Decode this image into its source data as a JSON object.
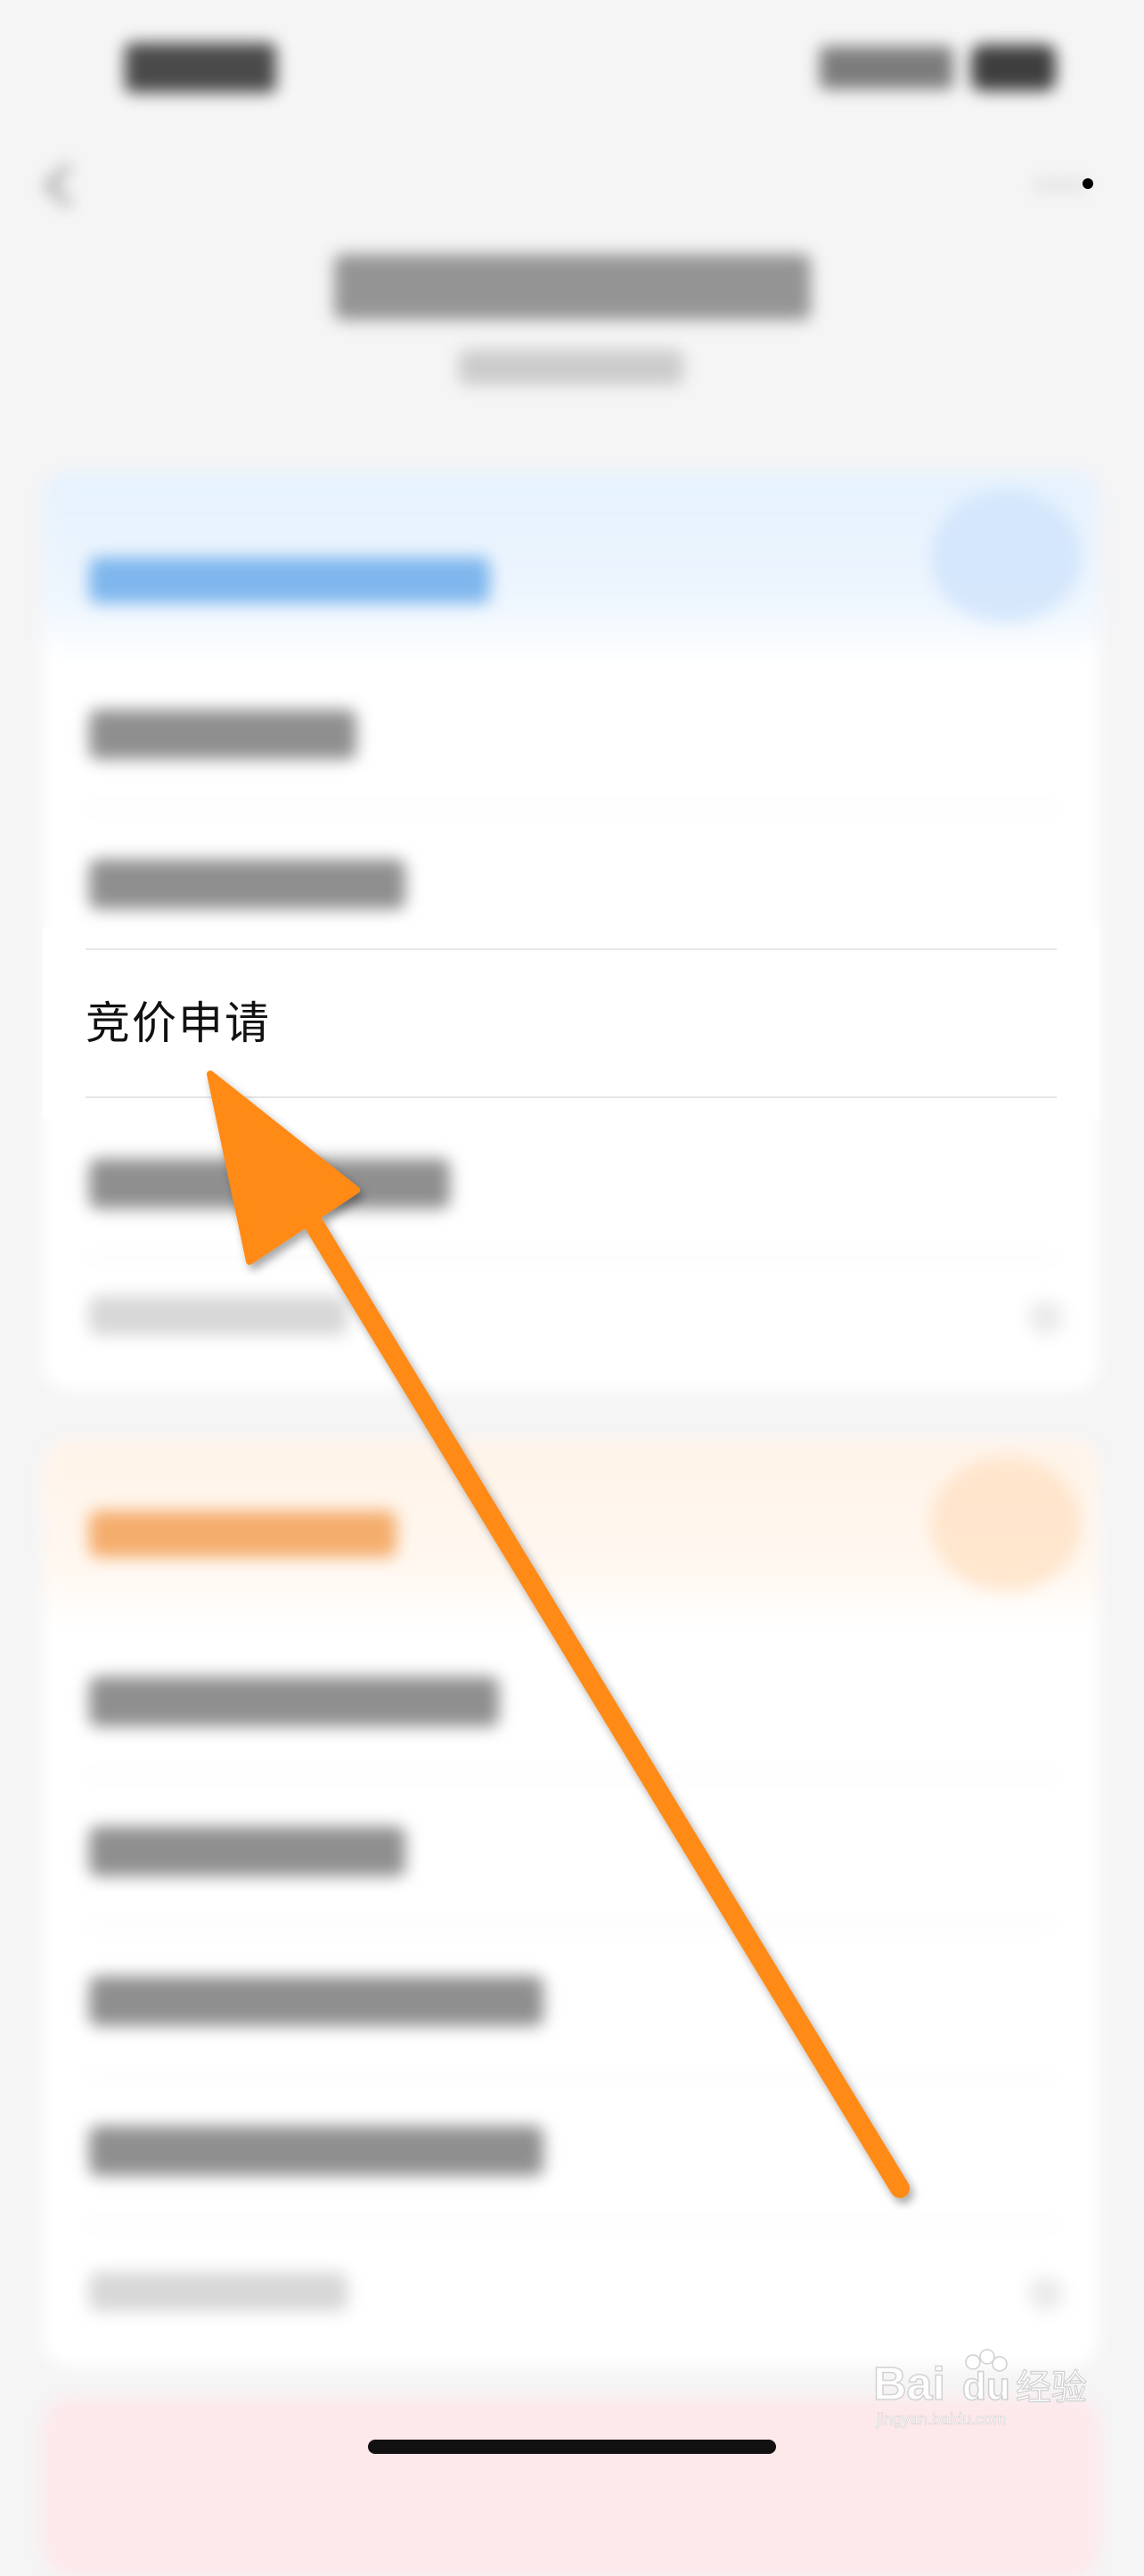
{
  "highlighted_item": {
    "label": "竞价申请"
  },
  "watermark": {
    "text": "Bai du 经验",
    "subtext": "jingyan.baidu.com"
  },
  "colors": {
    "arrow": "#ff8a12",
    "section1_accent": "#5aa2e8",
    "section2_accent": "#f39a4b",
    "background": "#f5f5f6"
  },
  "icons": {
    "back": "chevron-left-icon",
    "more": "more-icon"
  }
}
